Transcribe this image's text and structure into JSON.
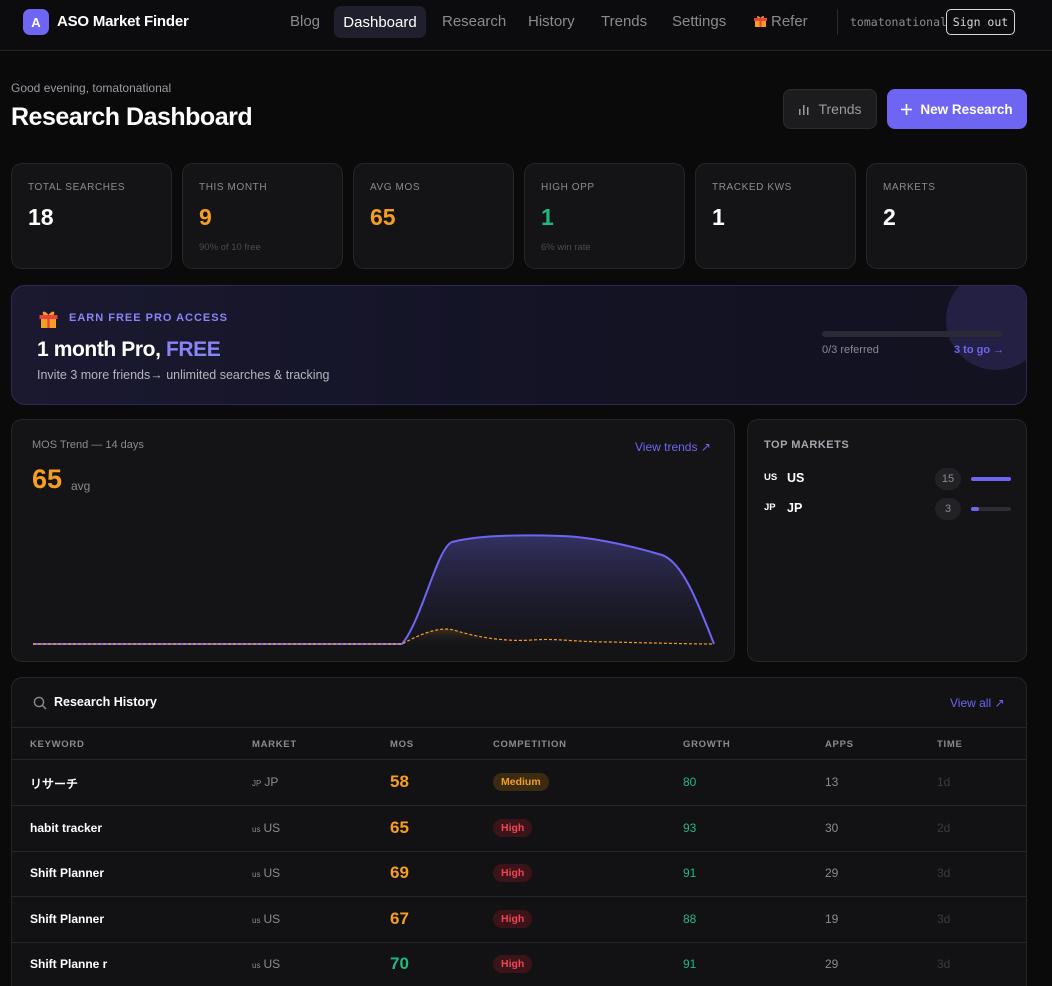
{
  "nav": {
    "brand_initial": "A",
    "brand": "ASO Market Finder",
    "links": [
      "Blog",
      "Dashboard",
      "Research",
      "History",
      "Trends",
      "Settings",
      "Refer"
    ],
    "active": "Dashboard",
    "user": "tomatonational",
    "signout": "Sign out"
  },
  "header": {
    "greeting": "Good evening, tomatonational",
    "title": "Research Dashboard",
    "trends_button": "Trends",
    "new_button": "New Research"
  },
  "stats": [
    {
      "label": "TOTAL SEARCHES",
      "value": "18",
      "sub": "",
      "color": "#ffffff"
    },
    {
      "label": "THIS MONTH",
      "value": "9",
      "sub": "90% of 10 free",
      "color": "#f59e22"
    },
    {
      "label": "AVG MOS",
      "value": "65",
      "sub": "",
      "color": "#f59e22"
    },
    {
      "label": "HIGH OPP",
      "value": "1",
      "sub": "6% win rate",
      "color": "#1fb97d"
    },
    {
      "label": "TRACKED KWS",
      "value": "1",
      "sub": "",
      "color": "#ffffff"
    },
    {
      "label": "MARKETS",
      "value": "2",
      "sub": "",
      "color": "#ffffff"
    }
  ],
  "promo": {
    "eyebrow": "EARN FREE PRO ACCESS",
    "headline_prefix": "1 month Pro, ",
    "headline_free": "FREE",
    "description": "Invite 3 more friends→ unlimited searches & tracking",
    "progress_text": "0/3 referred",
    "progress_fraction": 0,
    "to_go": "3 to go →"
  },
  "mos_trend": {
    "title": "MOS Trend — 14 days",
    "link": "View trends ↗",
    "value": "65",
    "unit": "avg"
  },
  "top_markets": {
    "title": "TOP MARKETS",
    "items": [
      {
        "flag": "US",
        "name": "US",
        "count": "15",
        "fraction": 1.0
      },
      {
        "flag": "JP",
        "name": "JP",
        "count": "3",
        "fraction": 0.2
      }
    ]
  },
  "history": {
    "title": "Research History",
    "view_all": "View all ↗",
    "columns": [
      "KEYWORD",
      "MARKET",
      "MOS",
      "COMPETITION",
      "GROWTH",
      "APPS",
      "TIME"
    ],
    "rows": [
      {
        "keyword": "リサーチ",
        "flag": "JP",
        "market": "JP",
        "mos": "58",
        "mos_color": "#f59e22",
        "competition": "Medium",
        "growth": "80",
        "apps": "13",
        "time": "1d"
      },
      {
        "keyword": "habit tracker",
        "flag": "us",
        "market": "US",
        "mos": "65",
        "mos_color": "#f59e22",
        "competition": "High",
        "growth": "93",
        "apps": "30",
        "time": "2d"
      },
      {
        "keyword": "Shift Planner",
        "flag": "us",
        "market": "US",
        "mos": "69",
        "mos_color": "#f59e22",
        "competition": "High",
        "growth": "91",
        "apps": "29",
        "time": "3d"
      },
      {
        "keyword": "Shift Planner",
        "flag": "us",
        "market": "US",
        "mos": "67",
        "mos_color": "#f59e22",
        "competition": "High",
        "growth": "88",
        "apps": "19",
        "time": "3d"
      },
      {
        "keyword": "Shift Planne r",
        "flag": "us",
        "market": "US",
        "mos": "70",
        "mos_color": "#1fb97d",
        "competition": "High",
        "growth": "91",
        "apps": "29",
        "time": "3d"
      }
    ]
  }
}
